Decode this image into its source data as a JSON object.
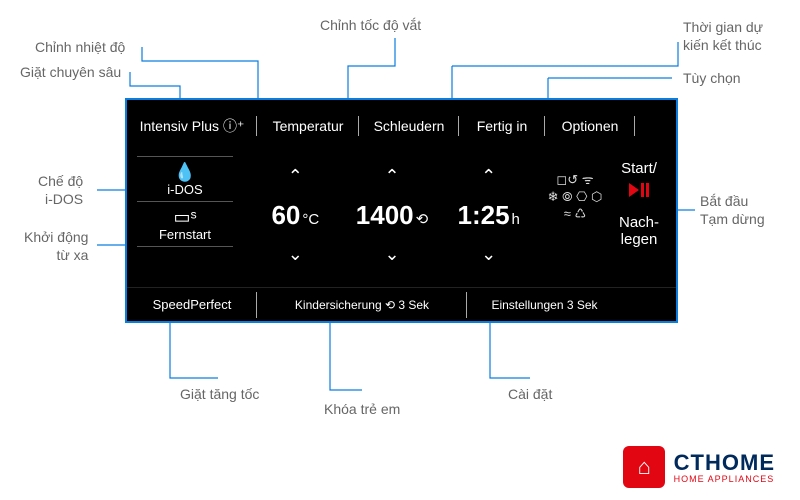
{
  "annotations": {
    "intensive": "Giặt chuyên sâu",
    "temperature": "Chỉnh nhiệt độ",
    "spin": "Chỉnh tốc độ vắt",
    "finish_in": "Thời gian dự\nkiến kết thúc",
    "options": "Tùy chọn",
    "idos": "Chế độ\ni-DOS",
    "remote_start": "Khởi động\ntừ xa",
    "start_pause": "Bắt đầu\nTạm dừng",
    "speedperfect": "Giặt tăng tốc",
    "childlock": "Khóa trẻ em",
    "settings": "Cài đặt"
  },
  "panel": {
    "top": {
      "intensiv": "Intensiv Plus",
      "temperatur": "Temperatur",
      "schleudern": "Schleudern",
      "fertig_in": "Fertig in",
      "optionen": "Optionen"
    },
    "left": {
      "idos": "i-DOS",
      "fernstart": "Fernstart"
    },
    "values": {
      "temp_value": "60",
      "temp_unit": "°C",
      "spin_value": "1400",
      "spin_unit": "⟲",
      "time_value": "1:25",
      "time_unit": "h"
    },
    "icons_row1": "◻↺ ᯤ",
    "icons_row2": "❄ ⦾ ⎔ ⬡",
    "icons_row3": "≈ ♺",
    "right": {
      "start": "Start/",
      "nachlegen": "Nach-\nlegen"
    },
    "bottom": {
      "speedperfect": "SpeedPerfect",
      "kindersicherung": "Kindersicherung  ⟲  3 Sek",
      "einstellungen": "Einstellungen 3 Sek"
    }
  },
  "logo": {
    "brand": "CTHOME",
    "sub": "HOME APPLIANCES"
  }
}
